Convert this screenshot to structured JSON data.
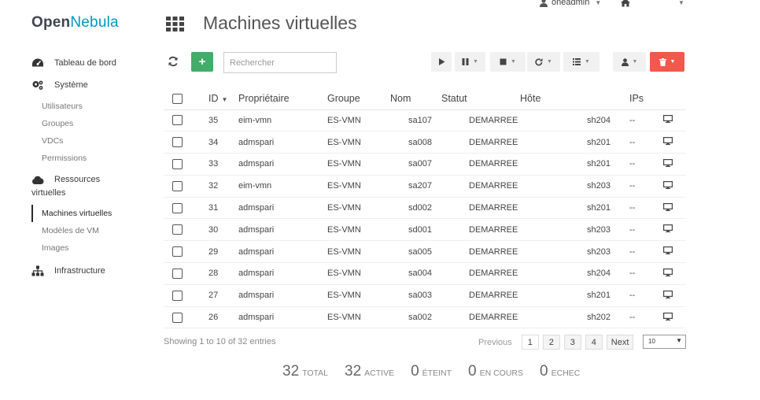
{
  "brand": {
    "open": "Open",
    "nebula": "Nebula"
  },
  "user": {
    "name": "oneadmin"
  },
  "sidebar": {
    "dashboard": "Tableau de bord",
    "system": "Système",
    "system_items": [
      "Utilisateurs",
      "Groupes",
      "VDCs",
      "Permissions"
    ],
    "virtual_resources_line1": "Ressources",
    "virtual_resources_line2": "virtuelles",
    "vr_items": [
      "Machines virtuelles",
      "Modèles de VM",
      "Images"
    ],
    "infrastructure": "Infrastructure"
  },
  "page": {
    "title": "Machines virtuelles"
  },
  "toolbar": {
    "add_label": "+",
    "search_placeholder": "Rechercher"
  },
  "table": {
    "headers": {
      "id": "ID",
      "owner": "Propriétaire",
      "group": "Groupe",
      "name": "Nom",
      "status": "Statut",
      "host": "Hôte",
      "ips": "IPs"
    },
    "rows": [
      {
        "id": "35",
        "owner": "eim-vmn",
        "group": "ES-VMN",
        "name": "sa107",
        "status": "DEMARREE",
        "host": "sh204",
        "ips": "--"
      },
      {
        "id": "34",
        "owner": "admspari",
        "group": "ES-VMN",
        "name": "sa008",
        "status": "DEMARREE",
        "host": "sh201",
        "ips": "--"
      },
      {
        "id": "33",
        "owner": "admspari",
        "group": "ES-VMN",
        "name": "sa007",
        "status": "DEMARREE",
        "host": "sh201",
        "ips": "--"
      },
      {
        "id": "32",
        "owner": "eim-vmn",
        "group": "ES-VMN",
        "name": "sa207",
        "status": "DEMARREE",
        "host": "sh203",
        "ips": "--"
      },
      {
        "id": "31",
        "owner": "admspari",
        "group": "ES-VMN",
        "name": "sd002",
        "status": "DEMARREE",
        "host": "sh201",
        "ips": "--"
      },
      {
        "id": "30",
        "owner": "admspari",
        "group": "ES-VMN",
        "name": "sd001",
        "status": "DEMARREE",
        "host": "sh203",
        "ips": "--"
      },
      {
        "id": "29",
        "owner": "admspari",
        "group": "ES-VMN",
        "name": "sa005",
        "status": "DEMARREE",
        "host": "sh203",
        "ips": "--"
      },
      {
        "id": "28",
        "owner": "admspari",
        "group": "ES-VMN",
        "name": "sa004",
        "status": "DEMARREE",
        "host": "sh204",
        "ips": "--"
      },
      {
        "id": "27",
        "owner": "admspari",
        "group": "ES-VMN",
        "name": "sa003",
        "status": "DEMARREE",
        "host": "sh201",
        "ips": "--"
      },
      {
        "id": "26",
        "owner": "admspari",
        "group": "ES-VMN",
        "name": "sa002",
        "status": "DEMARREE",
        "host": "sh202",
        "ips": "--"
      }
    ]
  },
  "footer": {
    "showing": "Showing 1 to 10 of 32 entries",
    "previous": "Previous",
    "pages": [
      "1",
      "2",
      "3",
      "4"
    ],
    "next": "Next",
    "page_size": "10"
  },
  "stats": [
    {
      "value": "32",
      "label": "TOTAL"
    },
    {
      "value": "32",
      "label": "ACTIVE"
    },
    {
      "value": "0",
      "label": "ÉTEINT"
    },
    {
      "value": "0",
      "label": "EN COURS"
    },
    {
      "value": "0",
      "label": "ECHEC"
    }
  ],
  "colors": {
    "brand_dark": "#3d4550",
    "brand_accent": "#0098c3",
    "add_green": "#43ac6a",
    "delete_red": "#f0594b"
  },
  "icons": {
    "dashboard": "tachometer-icon",
    "system": "cogs-icon",
    "virtual_resources": "cloud-icon",
    "infrastructure": "sitemap-icon",
    "apps": "th-grid-icon",
    "refresh": "refresh-icon",
    "vnc": "desktop-icon",
    "user": "user-icon",
    "home": "home-icon"
  }
}
